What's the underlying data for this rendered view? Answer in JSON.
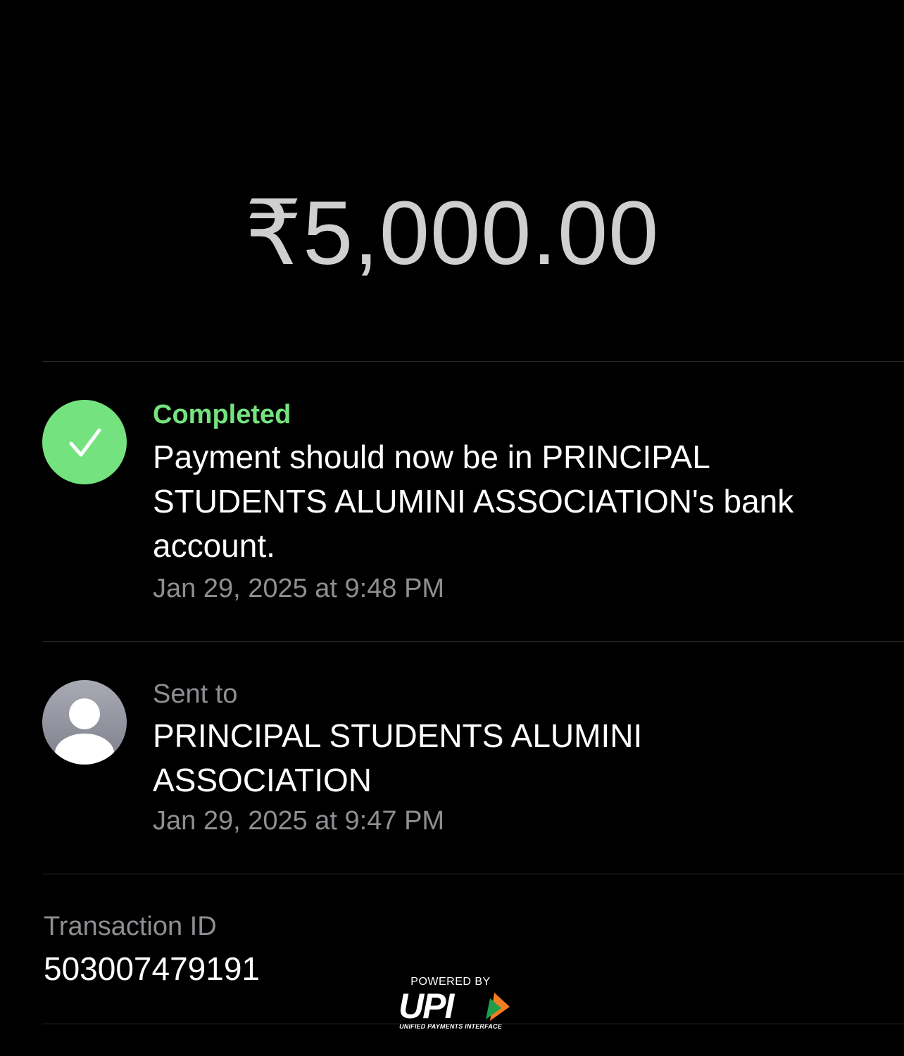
{
  "payment": {
    "amount": "₹5,000.00"
  },
  "status": {
    "icon": "checkmark-icon",
    "label": "Completed",
    "message": "Payment should now be in PRINCIPAL STUDENTS ALUMINI ASSOCIATION's bank account.",
    "timestamp": "Jan 29, 2025 at 9:48 PM",
    "color": "#74e37f"
  },
  "recipient": {
    "icon": "person-icon",
    "label": "Sent to",
    "name": "PRINCIPAL STUDENTS ALUMINI ASSOCIATION",
    "timestamp": "Jan 29, 2025 at 9:47 PM"
  },
  "transaction": {
    "label": "Transaction ID",
    "id": "503007479191"
  },
  "upi_badge": {
    "powered_by": "POWERED BY",
    "logo_text": "UPI",
    "subtitle": "UNIFIED PAYMENTS INTERFACE",
    "accent_colors": [
      "#f47c20",
      "#1e9e4a"
    ]
  }
}
